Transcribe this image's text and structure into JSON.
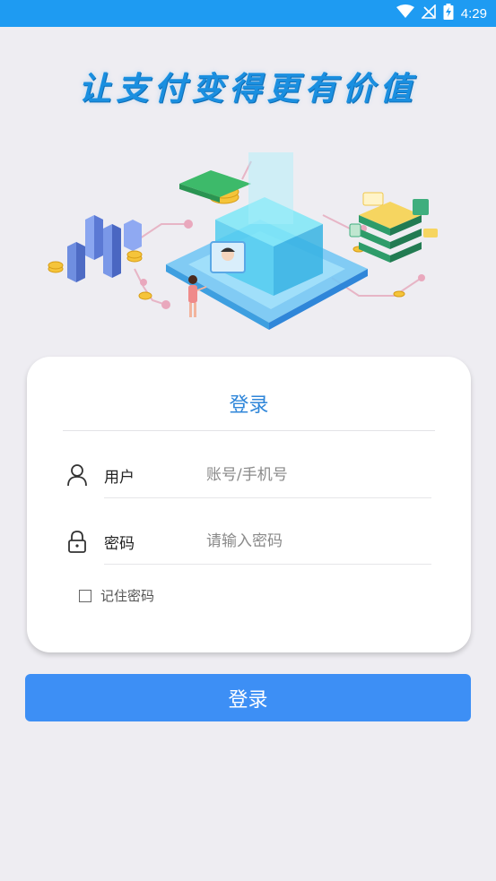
{
  "status_bar": {
    "time": "4:29",
    "color": "#1e9bf2"
  },
  "slogan": "让支付变得更有价值",
  "card": {
    "title": "登录",
    "username": {
      "label": "用户",
      "placeholder": "账号/手机号",
      "value": ""
    },
    "password": {
      "label": "密码",
      "placeholder": "请输入密码",
      "value": ""
    },
    "remember_label": "记住密码",
    "remember_checked": false
  },
  "login_button": "登录",
  "colors": {
    "accent": "#3d8ff5",
    "title": "#2f86d9",
    "background": "#eeedf2"
  }
}
